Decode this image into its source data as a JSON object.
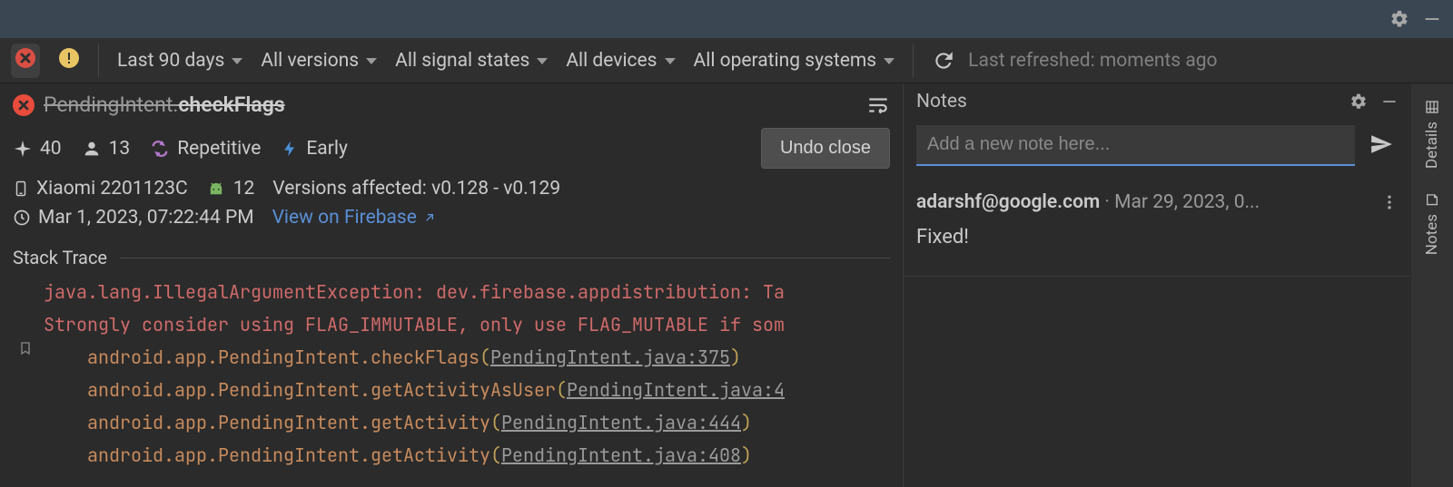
{
  "titlebar": {},
  "filters": {
    "date_range": "Last 90 days",
    "versions": "All versions",
    "signal_states": "All signal states",
    "devices": "All devices",
    "os": "All operating systems",
    "refreshed": "Last refreshed: moments ago"
  },
  "issue": {
    "class_part1": "PendingIntent.",
    "class_part2": "checkFlags",
    "events_count": "40",
    "users_count": "13",
    "signal_repetitive": "Repetitive",
    "signal_early": "Early",
    "undo_label": "Undo close",
    "device": "Xiaomi 2201123C",
    "android_api": "12",
    "versions_affected": "Versions affected: v0.128 - v0.129",
    "timestamp": "Mar 1, 2023, 07:22:44 PM",
    "firebase_link": "View on Firebase"
  },
  "stack": {
    "header": "Stack Trace",
    "line1": "java.lang.IllegalArgumentException: dev.firebase.appdistribution: Ta",
    "line2": "Strongly consider using FLAG_IMMUTABLE, only use FLAG_MUTABLE if som",
    "frame1_pkg": "android.app.PendingIntent.checkFlags",
    "frame1_file": "PendingIntent.java:375",
    "frame2_pkg": "android.app.PendingIntent.getActivityAsUser",
    "frame2_file": "PendingIntent.java:4",
    "frame3_pkg": "android.app.PendingIntent.getActivity",
    "frame3_file": "PendingIntent.java:444",
    "frame4_pkg": "android.app.PendingIntent.getActivity",
    "frame4_file": "PendingIntent.java:408"
  },
  "notes": {
    "title": "Notes",
    "placeholder": "Add a new note here...",
    "entry_author": "adarshf@google.com",
    "entry_sep": " · ",
    "entry_time": "Mar 29, 2023, 0...",
    "entry_body": "Fixed!"
  },
  "rail": {
    "details": "Details",
    "notes": "Notes"
  }
}
